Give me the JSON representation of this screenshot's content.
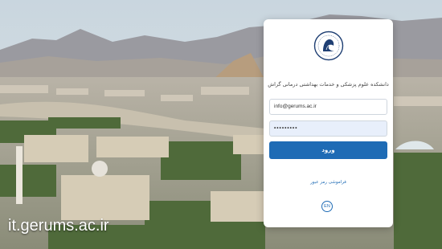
{
  "url_caption": "it.gerums.ac.ir",
  "login_card": {
    "university_title": "دانشکده علوم پزشکی و خدمات بهداشتی درمانی گراش",
    "email_value": "info@gerums.ac.ir",
    "password_value": "•••••••••",
    "login_button_label": "ورود",
    "forgot_password_link": "فراموشی رمز عبور",
    "language_button_label": "EN"
  },
  "colors": {
    "accent": "#1e6bb5",
    "card_background": "#ffffff",
    "password_field_background": "#e8effb"
  }
}
